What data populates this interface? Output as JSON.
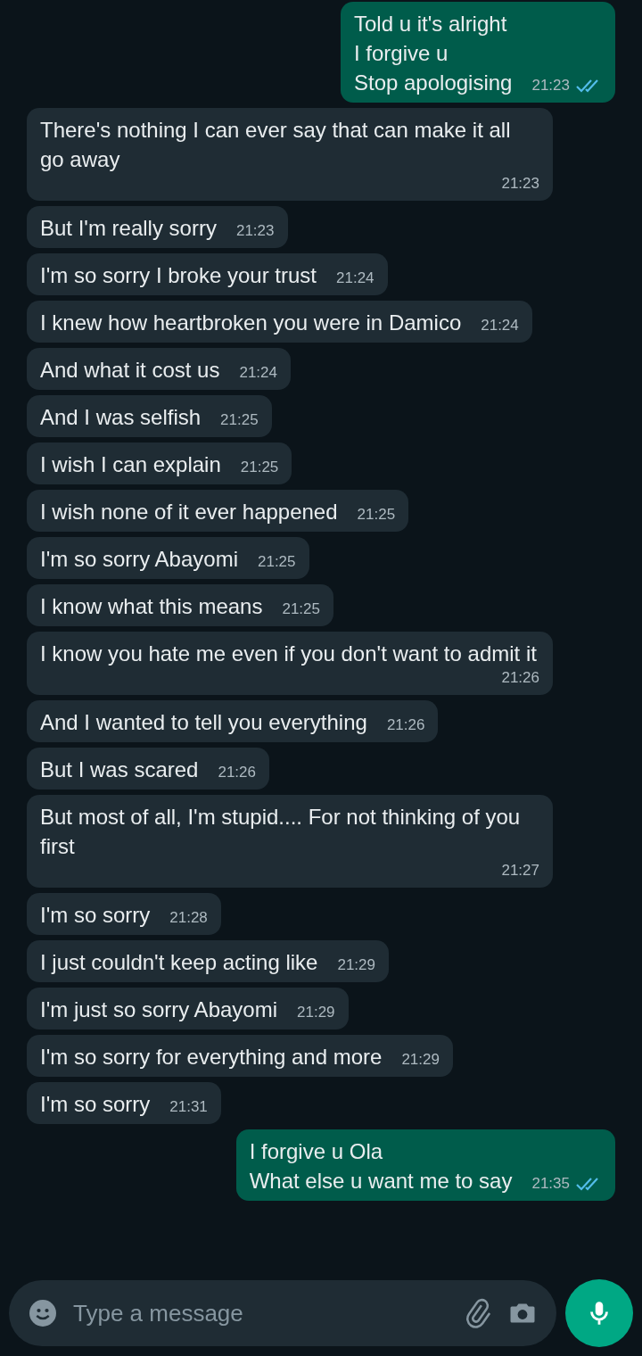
{
  "messages": [
    {
      "kind": "sent",
      "text": "Told u it's alright\nI forgive u\nStop apologising",
      "time": "21:23",
      "read": true
    },
    {
      "kind": "received",
      "text": "There's nothing I can ever say that can make it all go away",
      "time": "21:23"
    },
    {
      "kind": "received",
      "text": "But I'm really sorry",
      "time": "21:23"
    },
    {
      "kind": "received",
      "text": "I'm so sorry I broke your trust",
      "time": "21:24"
    },
    {
      "kind": "received",
      "text": "I knew how heartbroken you were in Damico",
      "time": "21:24"
    },
    {
      "kind": "received",
      "text": "And what it cost us",
      "time": "21:24"
    },
    {
      "kind": "received",
      "text": "And I was selfish",
      "time": "21:25"
    },
    {
      "kind": "received",
      "text": "I wish I can explain",
      "time": "21:25"
    },
    {
      "kind": "received",
      "text": "I wish none of it ever happened",
      "time": "21:25"
    },
    {
      "kind": "received",
      "text": "I'm so sorry Abayomi",
      "time": "21:25"
    },
    {
      "kind": "received",
      "text": "I know what this means",
      "time": "21:25"
    },
    {
      "kind": "received",
      "text": "I know you hate me even if you don't want to admit it",
      "time": "21:26"
    },
    {
      "kind": "received",
      "text": "And I wanted to tell you everything",
      "time": "21:26"
    },
    {
      "kind": "received",
      "text": "But I was scared",
      "time": "21:26"
    },
    {
      "kind": "received",
      "text": "But most of all, I'm stupid.... For not thinking of you first",
      "time": "21:27"
    },
    {
      "kind": "received",
      "text": "I'm so sorry",
      "time": "21:28"
    },
    {
      "kind": "received",
      "text": "I just couldn't keep acting like",
      "time": "21:29"
    },
    {
      "kind": "received",
      "text": "I'm just so sorry Abayomi",
      "time": "21:29"
    },
    {
      "kind": "received",
      "text": "I'm so sorry for everything and more",
      "time": "21:29"
    },
    {
      "kind": "received",
      "text": "I'm so sorry",
      "time": "21:31"
    },
    {
      "kind": "sent",
      "text": "I forgive u Ola\nWhat else u want me to say",
      "time": "21:35",
      "read": true
    }
  ],
  "composer": {
    "placeholder": "Type a message"
  }
}
